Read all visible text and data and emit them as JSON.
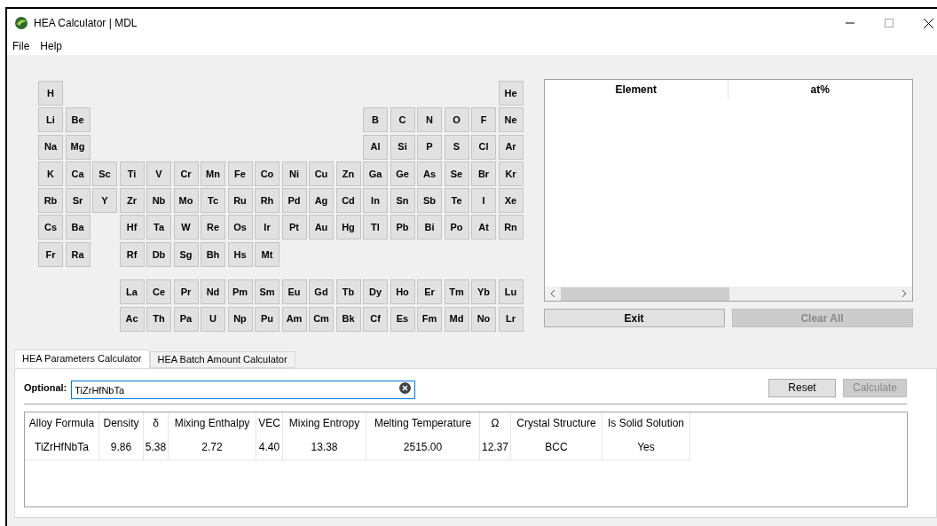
{
  "window": {
    "title": "HEA Calculator | MDL"
  },
  "menu": [
    "File",
    "Help"
  ],
  "periodic_table": {
    "rows": [
      [
        "H",
        "",
        "",
        "",
        "",
        "",
        "",
        "",
        "",
        "",
        "",
        "",
        "",
        "",
        "",
        "",
        "",
        "He"
      ],
      [
        "Li",
        "Be",
        "",
        "",
        "",
        "",
        "",
        "",
        "",
        "",
        "",
        "",
        "B",
        "C",
        "N",
        "O",
        "F",
        "Ne"
      ],
      [
        "Na",
        "Mg",
        "",
        "",
        "",
        "",
        "",
        "",
        "",
        "",
        "",
        "",
        "Al",
        "Si",
        "P",
        "S",
        "Cl",
        "Ar"
      ],
      [
        "K",
        "Ca",
        "Sc",
        "Ti",
        "V",
        "Cr",
        "Mn",
        "Fe",
        "Co",
        "Ni",
        "Cu",
        "Zn",
        "Ga",
        "Ge",
        "As",
        "Se",
        "Br",
        "Kr"
      ],
      [
        "Rb",
        "Sr",
        "Y",
        "Zr",
        "Nb",
        "Mo",
        "Tc",
        "Ru",
        "Rh",
        "Pd",
        "Ag",
        "Cd",
        "In",
        "Sn",
        "Sb",
        "Te",
        "I",
        "Xe"
      ],
      [
        "Cs",
        "Ba",
        "",
        "Hf",
        "Ta",
        "W",
        "Re",
        "Os",
        "Ir",
        "Pt",
        "Au",
        "Hg",
        "Tl",
        "Pb",
        "Bi",
        "Po",
        "At",
        "Rn"
      ],
      [
        "Fr",
        "Ra",
        "",
        "Rf",
        "Db",
        "Sg",
        "Bh",
        "Hs",
        "Mt"
      ]
    ],
    "f_rows": [
      [
        "",
        "",
        "",
        "La",
        "Ce",
        "Pr",
        "Nd",
        "Pm",
        "Sm",
        "Eu",
        "Gd",
        "Tb",
        "Dy",
        "Ho",
        "Er",
        "Tm",
        "Yb",
        "Lu"
      ],
      [
        "",
        "",
        "",
        "Ac",
        "Th",
        "Pa",
        "U",
        "Np",
        "Pu",
        "Am",
        "Cm",
        "Bk",
        "Cf",
        "Es",
        "Fm",
        "Md",
        "No",
        "Lr"
      ]
    ]
  },
  "composition_table": {
    "columns": [
      "Element",
      "at%"
    ]
  },
  "buttons": [
    {
      "label": "Exit",
      "disabled": false
    },
    {
      "label": "Clear All",
      "disabled": true
    }
  ],
  "tabs": [
    {
      "label": "HEA Parameters Calculator",
      "selected": true
    },
    {
      "label": "HEA Batch Amount Calculator",
      "selected": false
    }
  ],
  "formula_field": {
    "label": "Optional:",
    "value": "TiZrHfNbTa"
  },
  "actions": [
    {
      "label": "Reset",
      "disabled": false
    },
    {
      "label": "Calculate",
      "disabled": true
    }
  ],
  "results_table": {
    "columns": [
      "Alloy Formula",
      "Density",
      "δ",
      "Mixing Enthalpy",
      "VEC",
      "Mixing Entropy",
      "Melting Temperature",
      "Ω",
      "Crystal Structure",
      "Is Solid Solution"
    ],
    "rows": [
      [
        "TiZrHfNbTa",
        "9.86",
        "5.38",
        "2.72",
        "4.40",
        "13.38",
        "2515.00",
        "12.37",
        "BCC",
        "Yes"
      ]
    ]
  }
}
